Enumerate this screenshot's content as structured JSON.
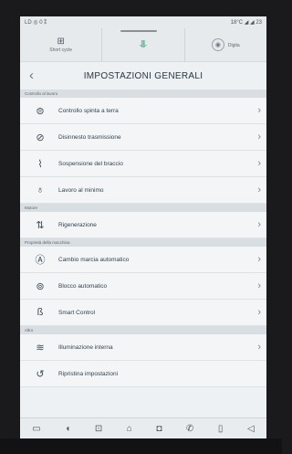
{
  "status": {
    "left": "LD ◎ 0 ⁑",
    "right": "18°C ◢ ◢ 23"
  },
  "header": {
    "left_label": "Short cycle",
    "left_icon": "grid-machine-icon",
    "center_icon": "filter-down-icon",
    "right_icon": "camera-icon",
    "right_label": "Digita"
  },
  "page": {
    "title": "IMPOSTAZIONI GENERALI"
  },
  "sections": [
    {
      "label": "Controllo al lavoro",
      "items": [
        {
          "label": "Controllo spinta a terra",
          "chev": true,
          "icon": "ground-push-icon"
        },
        {
          "label": "Disinnesto trasmissione",
          "chev": true,
          "icon": "transmission-icon"
        },
        {
          "label": "Sospensione del braccio",
          "chev": true,
          "icon": "boom-suspension-icon"
        },
        {
          "label": "Lavoro al minimo",
          "chev": true,
          "icon": "idle-work-icon"
        }
      ]
    },
    {
      "label": "Motore",
      "items": [
        {
          "label": "Rigenerazione",
          "chev": true,
          "icon": "regeneration-icon"
        }
      ]
    },
    {
      "label": "Proprietà della macchina",
      "items": [
        {
          "label": "Cambio marcia automatico",
          "chev": true,
          "icon": "auto-shift-icon"
        },
        {
          "label": "Blocco automatico",
          "chev": true,
          "icon": "auto-lock-icon"
        },
        {
          "label": "Smart Control",
          "chev": true,
          "icon": "smart-control-icon"
        }
      ]
    },
    {
      "label": "Altro",
      "items": [
        {
          "label": "Illuminazione interna",
          "chev": true,
          "icon": "interior-light-icon"
        },
        {
          "label": "Ripristina impostazioni",
          "chev": false,
          "icon": "reset-icon"
        }
      ]
    }
  ],
  "bottom_nav": [
    "home-icon",
    "tractor-icon",
    "machine-icon",
    "house-icon",
    "camera-icon",
    "phone-icon",
    "tablet-icon",
    "volume-icon"
  ]
}
